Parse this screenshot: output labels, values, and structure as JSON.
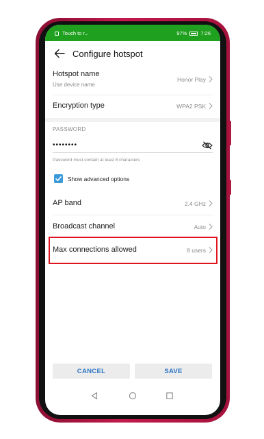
{
  "status": {
    "notification": "Touch to r...",
    "battery": "97%",
    "time": "7:26"
  },
  "header": {
    "title": "Configure hotspot"
  },
  "settings": {
    "hotspot_name": {
      "label": "Hotspot name",
      "sub": "Use device name",
      "value": "Honor Play"
    },
    "encryption": {
      "label": "Encryption type",
      "value": "WPA2 PSK"
    },
    "password": {
      "section": "PASSWORD",
      "masked": "••••••••",
      "hint": "Password must contain at least 8 characters"
    },
    "advanced": {
      "label": "Show advanced options",
      "checked": true
    },
    "ap_band": {
      "label": "AP band",
      "value": "2.4 GHz"
    },
    "broadcast_channel": {
      "label": "Broadcast channel",
      "value": "Auto"
    },
    "max_connections": {
      "label": "Max connections allowed",
      "value": "8 users"
    }
  },
  "actions": {
    "cancel": "CANCEL",
    "save": "SAVE"
  },
  "icons": [
    "back-arrow-icon",
    "chevron-right-icon",
    "eye-off-icon",
    "check-icon",
    "nav-back-icon",
    "nav-home-icon",
    "nav-recents-icon"
  ],
  "colors": {
    "status_bar": "#1fa01f",
    "accent": "#2a73c4",
    "checkbox": "#3a9bd8",
    "highlight": "#e0141e",
    "phone_body": "#c21a4c"
  }
}
